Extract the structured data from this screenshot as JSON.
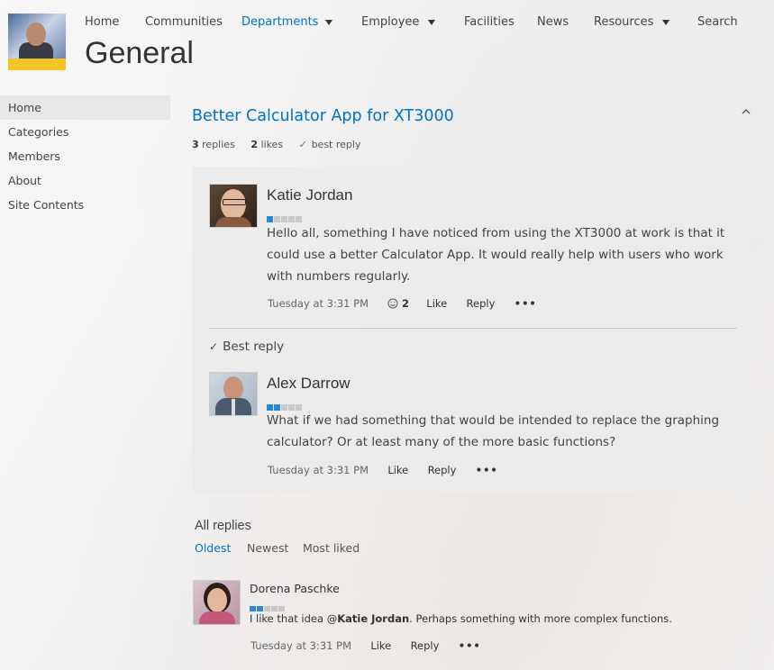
{
  "nav": {
    "items": [
      "Home",
      "Communities",
      "Departments",
      "Employee",
      "Facilities",
      "News",
      "Resources",
      "Search"
    ],
    "active": "Departments"
  },
  "site": {
    "title": "General"
  },
  "leftnav": {
    "items": [
      "Home",
      "Categories",
      "Members",
      "About",
      "Site Contents"
    ],
    "selected": "Home"
  },
  "thread": {
    "title": "Better Calculator App for XT3000",
    "replies_count": "3",
    "replies_label": "replies",
    "likes_count": "2",
    "likes_label": "likes",
    "best_reply_label": "best reply"
  },
  "original_post": {
    "author": "Katie Jordan",
    "rank": 1,
    "body": "Hello all, something I have noticed from using the XT3000 at work is that it could use a better Calculator App.  It would really help with users who work with numbers regularly.",
    "timestamp": "Tuesday at 3:31 PM",
    "like_count": "2",
    "like_label": "Like",
    "reply_label": "Reply",
    "more_label": "•••"
  },
  "best_reply": {
    "heading": "Best reply",
    "author": "Alex Darrow",
    "rank": 2,
    "body": "What if we had something that would  be intended to replace the graphing calculator? Or at least many of the more basic functions?",
    "timestamp": "Tuesday at 3:31 PM",
    "like_label": "Like",
    "reply_label": "Reply",
    "more_label": "•••"
  },
  "all_replies": {
    "heading": "All replies",
    "sort_options": [
      "Oldest",
      "Newest",
      "Most liked"
    ],
    "sort_selected": "Oldest",
    "items": [
      {
        "author": "Dorena Paschke",
        "rank": 2,
        "body_prefix": "I like that idea @",
        "mention": "Katie Jordan",
        "body_suffix": ".  Perhaps something with more complex functions.",
        "timestamp": "Tuesday at 3:31 PM",
        "like_label": "Like",
        "reply_label": "Reply",
        "more_label": "•••"
      }
    ]
  },
  "colors": {
    "accent": "#0072c6",
    "rank_on": "#2b88d8",
    "rank_off": "#c8c8c8",
    "logo_bar": "#f5c526"
  },
  "icons": {
    "collapse": "chevron-up-icon",
    "dropdown": "caret-down-icon",
    "check": "checkmark-icon",
    "like_count": "smiley-icon",
    "more": "ellipsis-icon"
  }
}
